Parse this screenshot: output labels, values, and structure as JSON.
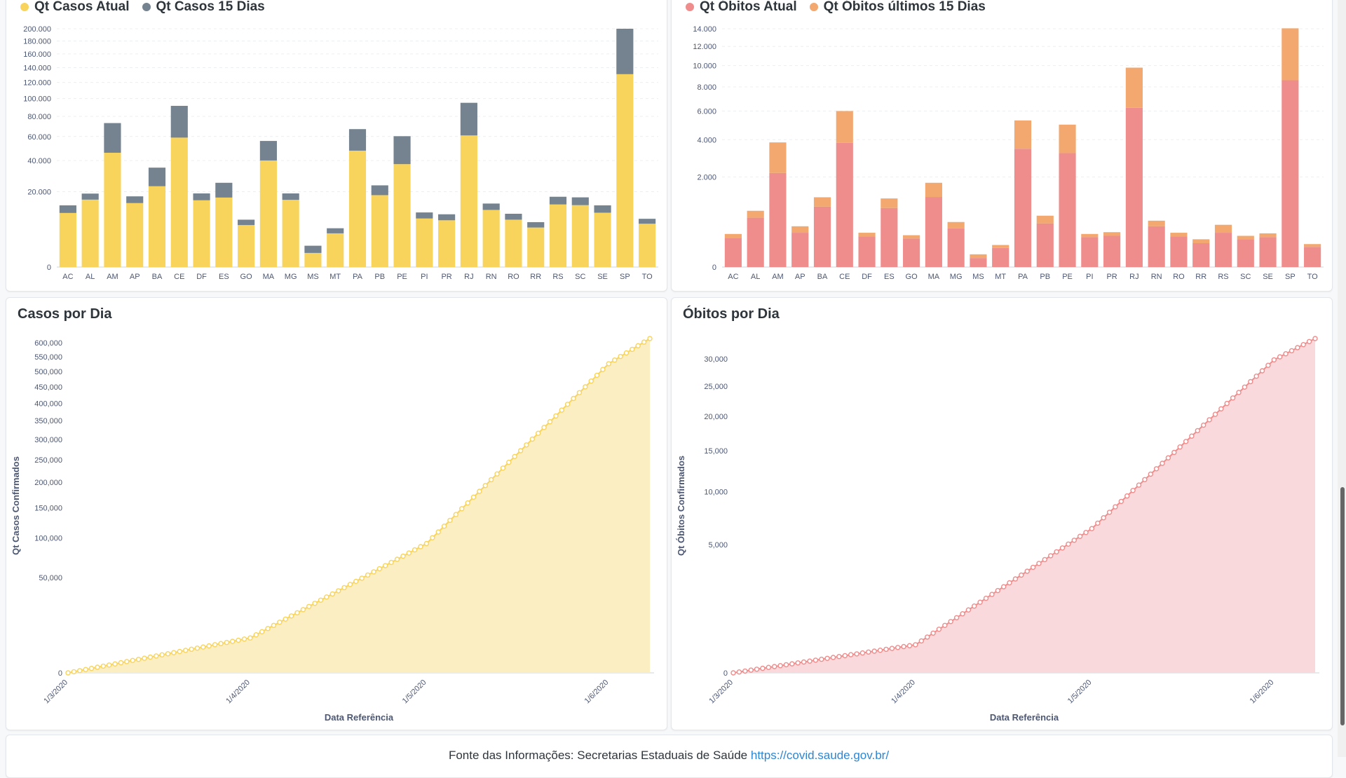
{
  "states": [
    "AC",
    "AL",
    "AM",
    "AP",
    "BA",
    "CE",
    "DF",
    "ES",
    "GO",
    "MA",
    "MG",
    "MS",
    "MT",
    "PA",
    "PB",
    "PE",
    "PI",
    "PR",
    "RJ",
    "RN",
    "RO",
    "RR",
    "RS",
    "SC",
    "SE",
    "SP",
    "TO"
  ],
  "colors": {
    "casos_atual": "#f9d45c",
    "casos_15": "#74838f",
    "obitos_atual": "#ef8c8c",
    "obitos_15": "#f2a86f",
    "casos_line": "#f9d45c",
    "casos_area": "#fbeec2",
    "obitos_line": "#ef8c8c",
    "obitos_area": "#f9d9db"
  },
  "footer": {
    "text": "Fonte das Informações: Secretarias Estaduais de Saúde",
    "link": "https://covid.saude.gov.br/"
  },
  "chart_data": [
    {
      "id": "casos-por-estado",
      "type": "bar",
      "stacked": true,
      "y_scale": "sqrt",
      "ylim": [
        0,
        200000
      ],
      "yticks": [
        0,
        20000,
        40000,
        60000,
        80000,
        100000,
        120000,
        140000,
        160000,
        180000,
        200000
      ],
      "ytick_labels": [
        "0",
        "20.000",
        "40.000",
        "60.000",
        "80.000",
        "100.000",
        "120.000",
        "140.000",
        "160.000",
        "180.000",
        "200.000"
      ],
      "title": "",
      "legend_position": "top-left",
      "grid": true,
      "series": [
        {
          "name": "Qt Casos Atual",
          "values": [
            10300,
            16000,
            46000,
            14400,
            23000,
            59000,
            15700,
            17000,
            6200,
            40000,
            15900,
            700,
            4000,
            47700,
            18200,
            37300,
            8300,
            7700,
            61000,
            11500,
            7900,
            5500,
            13800,
            13500,
            10400,
            131000,
            6600
          ]
        },
        {
          "name": "Qt Casos 15 Dias",
          "values": [
            3100,
            3000,
            27000,
            3200,
            11800,
            32500,
            3400,
            8000,
            1700,
            16000,
            3200,
            900,
            1300,
            19300,
            5300,
            23000,
            2200,
            2100,
            34000,
            2700,
            2100,
            1600,
            3600,
            3600,
            3000,
            69000,
            1600
          ]
        }
      ]
    },
    {
      "id": "obitos-por-estado",
      "type": "bar",
      "stacked": true,
      "y_scale": "sqrt",
      "ylim": [
        0,
        14000
      ],
      "yticks": [
        0,
        2000,
        4000,
        6000,
        8000,
        10000,
        12000,
        14000
      ],
      "ytick_labels": [
        "0",
        "2.000",
        "4.000",
        "6.000",
        "8.000",
        "10.000",
        "12.000",
        "14.000"
      ],
      "title": "",
      "legend_position": "top-left",
      "grid": true,
      "series": [
        {
          "name": "Qt Óbitos Atual",
          "values": [
            210,
            600,
            2180,
            290,
            900,
            3800,
            230,
            860,
            200,
            1210,
            370,
            20,
            90,
            3450,
            470,
            3200,
            220,
            240,
            6250,
            410,
            230,
            140,
            290,
            190,
            220,
            8600,
            100
          ]
        },
        {
          "name": "Qt Óbitos últimos 15 Dias",
          "values": [
            60,
            180,
            1650,
            120,
            300,
            2200,
            60,
            300,
            50,
            540,
            130,
            20,
            30,
            1850,
            180,
            1800,
            50,
            60,
            3550,
            120,
            60,
            50,
            150,
            50,
            60,
            5450,
            30
          ]
        }
      ]
    },
    {
      "id": "casos-por-dia",
      "type": "area",
      "title": "Casos por Dia",
      "xlabel": "Data Referência",
      "ylabel": "Qt Casos Confirmados",
      "y_scale": "sqrt",
      "ylim": [
        0,
        615000
      ],
      "yticks": [
        0,
        50000,
        100000,
        150000,
        200000,
        250000,
        300000,
        350000,
        400000,
        450000,
        500000,
        550000,
        600000
      ],
      "ytick_labels": [
        "0",
        "50,000",
        "100,000",
        "150,000",
        "200,000",
        "250,000",
        "300,000",
        "350,000",
        "400,000",
        "450,000",
        "500,000",
        "550,000",
        "600,000"
      ],
      "x_start": "1/3/2020",
      "x_ticks": [
        "1/3/2020",
        "1/4/2020",
        "1/5/2020",
        "1/6/2020"
      ],
      "x": [
        "1/3/2020",
        "1/4/2020",
        "1/5/2020",
        "1/6/2020",
        "8/6/2020"
      ],
      "values": [
        0,
        6700,
        92000,
        526000,
        615000
      ],
      "grid": false
    },
    {
      "id": "obitos-por-dia",
      "type": "area",
      "title": "Óbitos por Dia",
      "xlabel": "Data Referência",
      "ylabel": "Qt Óbitos Confirmados",
      "y_scale": "sqrt",
      "ylim": [
        0,
        34000
      ],
      "yticks": [
        0,
        5000,
        10000,
        15000,
        20000,
        25000,
        30000
      ],
      "ytick_labels": [
        "0",
        "5,000",
        "10,000",
        "15,000",
        "20,000",
        "25,000",
        "30,000"
      ],
      "x_start": "1/3/2020",
      "x_ticks": [
        "1/3/2020",
        "1/4/2020",
        "1/5/2020",
        "1/6/2020"
      ],
      "x": [
        "1/3/2020",
        "1/4/2020",
        "1/5/2020",
        "1/6/2020",
        "8/6/2020"
      ],
      "values": [
        0,
        240,
        6330,
        29800,
        34000
      ],
      "grid": false
    }
  ]
}
